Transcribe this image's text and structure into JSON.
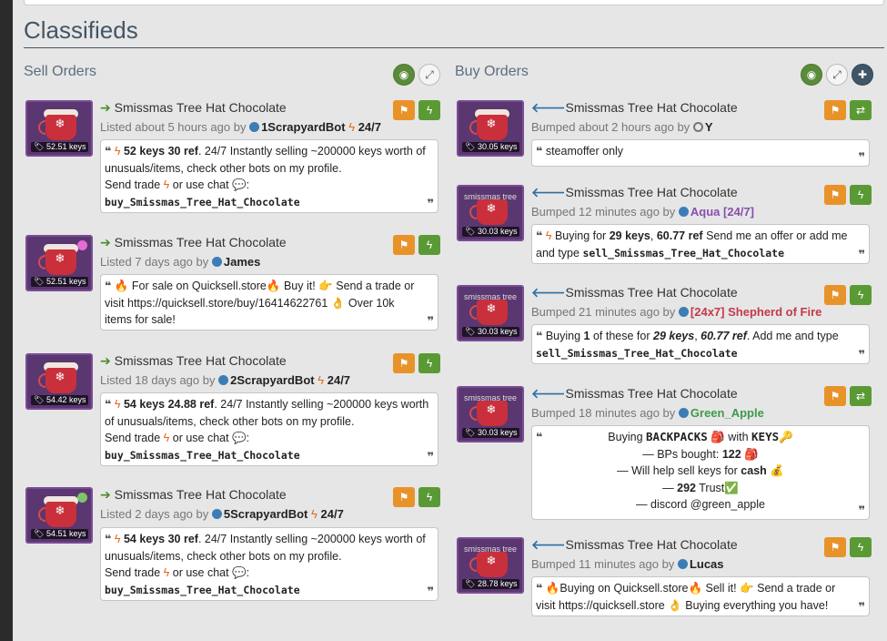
{
  "title": "Classifieds",
  "sell": {
    "heading": "Sell Orders",
    "listings": [
      {
        "item": "Smissmas Tree Hat Chocolate",
        "price": "52.51 keys",
        "meta_prefix": "Listed about 5 hours ago by",
        "user": "1ScrapyardBot",
        "user_suffix": "24/7",
        "desc_price": "52 keys 30 ref",
        "desc_text": ". 24/7 Instantly selling ~200000 keys worth of unusuals/items, check other bots on my profile.",
        "send": "Send trade",
        "or_use": "or use chat",
        "cmd": "buy_Smissmas_Tree_Hat_Chocolate"
      },
      {
        "item": "Smissmas Tree Hat Chocolate",
        "price": "52.51 keys",
        "meta_prefix": "Listed 7 days ago by",
        "user": "James",
        "desc_line1": "For sale on Quicksell.store",
        "desc_buy": "Buy it!",
        "desc_line1b": "Send a trade or",
        "desc_line2": "visit https://quicksell.store/buy/16414622761",
        "desc_line2b": "Over 10k",
        "desc_line3": "items for sale!",
        "dot_color": "#e76bd6"
      },
      {
        "item": "Smissmas Tree Hat Chocolate",
        "price": "54.42 keys",
        "meta_prefix": "Listed 18 days ago by",
        "user": "2ScrapyardBot",
        "user_suffix": "24/7",
        "desc_price": "54 keys 24.88 ref",
        "desc_text": ". 24/7 Instantly selling ~200000 keys worth of unusuals/items, check other bots on my profile.",
        "send": "Send trade",
        "or_use": "or use chat",
        "cmd": "buy_Smissmas_Tree_Hat_Chocolate"
      },
      {
        "item": "Smissmas Tree Hat Chocolate",
        "price": "54.51 keys",
        "meta_prefix": "Listed 2 days ago by",
        "user": "5ScrapyardBot",
        "user_suffix": "24/7",
        "desc_price": "54 keys 30 ref",
        "desc_text": ". 24/7 Instantly selling ~200000 keys worth of unusuals/items, check other bots on my profile.",
        "send": "Send trade",
        "or_use": "or use chat",
        "cmd": "buy_Smissmas_Tree_Hat_Chocolate",
        "dot_color": "#7fc46a"
      }
    ]
  },
  "buy": {
    "heading": "Buy Orders",
    "listings": [
      {
        "item": "Smissmas Tree Hat Chocolate",
        "price": "30.05 keys",
        "meta_prefix": "Bumped about 2 hours ago by",
        "user": "Y",
        "desc": "steamoffer only"
      },
      {
        "item": "Smissmas Tree Hat Chocolate",
        "price": "30.03 keys",
        "tag": "smissmas tree",
        "meta_prefix": "Bumped 12 minutes ago by",
        "user": "Aqua [24/7]",
        "user_color": "#8650ac",
        "desc_a": "Buying for",
        "desc_b": "29 keys",
        "desc_c": "60.77 ref",
        "desc_d": "Send me an offer or add me and type",
        "cmd": "sell_Smissmas_Tree_Hat_Chocolate"
      },
      {
        "item": "Smissmas Tree Hat Chocolate",
        "price": "30.03 keys",
        "tag": "smissmas tree",
        "meta_prefix": "Bumped 21 minutes ago by",
        "user": "[24x7] Shepherd of Fire",
        "user_color": "#c4394a",
        "desc_a": "Buying",
        "desc_b": "1",
        "desc_c": "of these for",
        "desc_d": "29 keys",
        "desc_e": "60.77 ref",
        "desc_f": ". Add me and type",
        "cmd": "sell_Smissmas_Tree_Hat_Chocolate"
      },
      {
        "item": "Smissmas Tree Hat Chocolate",
        "price": "30.03 keys",
        "tag": "smissmas tree",
        "meta_prefix": "Bumped 18 minutes ago by",
        "user": "Green_Apple",
        "user_color": "#3e9a4a",
        "l1a": "Buying",
        "l1b": "BACKPACKS",
        "l1c": "with",
        "l1d": "KEYS",
        "l2a": "— BPs bought:",
        "l2b": "122",
        "l3a": "— Will help sell keys for",
        "l3b": "cash",
        "l4a": "—",
        "l4b": "292",
        "l4c": "Trust",
        "l5": "— discord @green_apple"
      },
      {
        "item": "Smissmas Tree Hat Chocolate",
        "price": "28.78 keys",
        "tag": "smissmas tree",
        "meta_prefix": "Bumped 11 minutes ago by",
        "user": "Lucas",
        "desc_line1": "Buying on Quicksell.store",
        "desc_sell": "Sell it!",
        "desc_line1b": "Send a trade or",
        "desc_line2": "visit https://quicksell.store",
        "desc_line2b": "Buying everything you have!"
      }
    ]
  }
}
